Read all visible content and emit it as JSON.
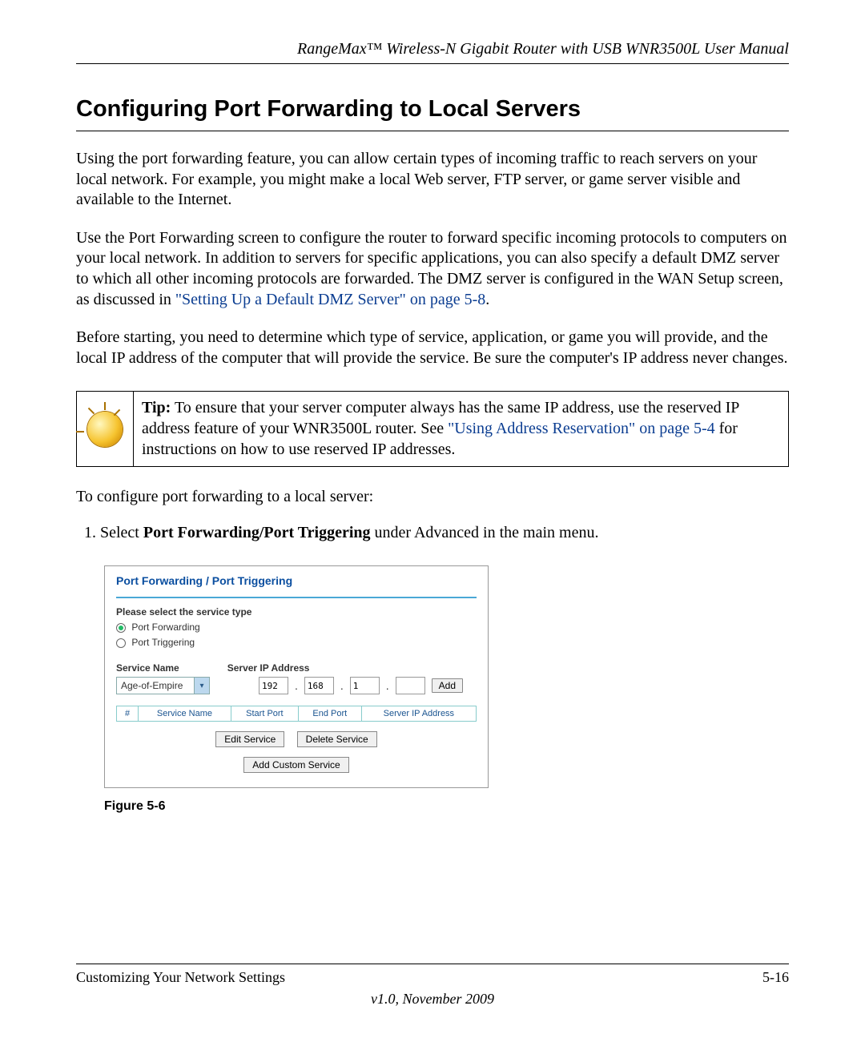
{
  "header": {
    "manual_title": "RangeMax™ Wireless-N Gigabit Router with USB WNR3500L User Manual"
  },
  "section": {
    "title": "Configuring Port Forwarding to Local Servers"
  },
  "paragraphs": {
    "p1": "Using the port forwarding feature, you can allow certain types of incoming traffic to reach servers on your local network. For example, you might make a local Web server, FTP server, or game server visible and available to the Internet.",
    "p2a": "Use the Port Forwarding screen to configure the router to forward specific incoming protocols to computers on your local network. In addition to servers for specific applications, you can also specify a default DMZ server to which all other incoming protocols are forwarded. The DMZ server is configured in the WAN Setup screen, as discussed in ",
    "p2_link": "\"Setting Up a Default DMZ Server\" on page 5-8",
    "p2b": ".",
    "p3": "Before starting, you need to determine which type of service, application, or game you will provide, and the local IP address of the computer that will provide the service. Be sure the computer's IP address never changes."
  },
  "tip": {
    "label": "Tip:",
    "part1": " To ensure that your server computer always has the same IP address, use the reserved IP address feature of your WNR3500L router. See ",
    "link": "\"Using Address Reservation\" on page 5-4",
    "part2": " for instructions on how to use reserved IP addresses."
  },
  "intro_steps": "To configure port forwarding to a local server:",
  "step1": {
    "pre": "Select ",
    "bold": "Port Forwarding/Port Triggering",
    "post": " under Advanced in the main menu."
  },
  "screenshot": {
    "title": "Port Forwarding / Port Triggering",
    "select_type": "Please select the service type",
    "radio_forwarding": "Port Forwarding",
    "radio_triggering": "Port Triggering",
    "service_name_label": "Service Name",
    "server_ip_label": "Server IP Address",
    "service_selected": "Age-of-Empire",
    "ip": {
      "o1": "192",
      "o2": "168",
      "o3": "1",
      "o4": ""
    },
    "add_btn": "Add",
    "table": {
      "col_num": "#",
      "col_service": "Service Name",
      "col_start": "Start Port",
      "col_end": "End Port",
      "col_ip": "Server IP Address"
    },
    "edit_btn": "Edit Service",
    "delete_btn": "Delete Service",
    "custom_btn": "Add Custom Service"
  },
  "figure_label": "Figure 5-6",
  "footer": {
    "section": "Customizing Your Network Settings",
    "page": "5-16",
    "version": "v1.0, November 2009"
  }
}
